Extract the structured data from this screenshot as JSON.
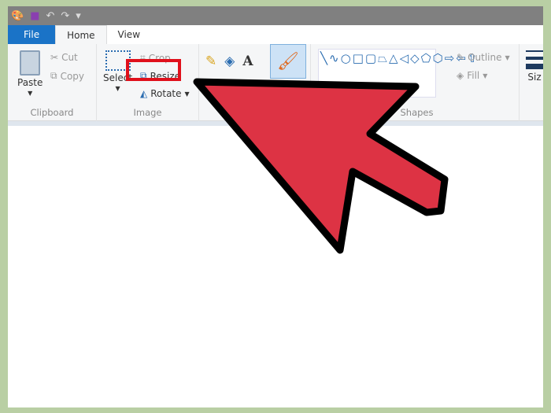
{
  "quick_access": {
    "icons": [
      "paint-icon",
      "save-icon",
      "undo-icon",
      "redo-icon",
      "customize-icon"
    ]
  },
  "tabs": [
    {
      "label": "File"
    },
    {
      "label": "Home"
    },
    {
      "label": "View"
    }
  ],
  "clipboard": {
    "paste": "Paste",
    "cut": "Cut",
    "copy": "Copy",
    "label": "Clipboard"
  },
  "image": {
    "select": "Select",
    "crop": "Crop",
    "resize": "Resize",
    "rotate": "Rotate",
    "label": "Image"
  },
  "shapes": {
    "outline": "Outline",
    "fill": "Fill",
    "label": "Shapes"
  },
  "size": {
    "label": "Siz"
  },
  "colors": {
    "highlight": "#e0101b",
    "arrow_fill": "#dd3344",
    "accent": "#1a73c7"
  }
}
